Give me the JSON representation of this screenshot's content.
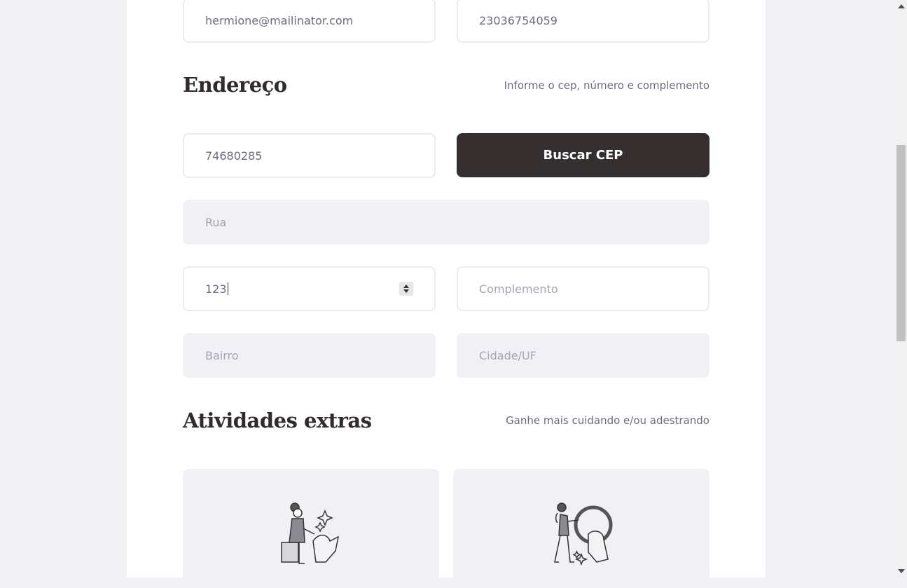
{
  "contact": {
    "email_value": "hermione@mailinator.com",
    "phone_value": "23036754059"
  },
  "address": {
    "title": "Endereço",
    "hint": "Informe o cep, número e complemento",
    "cep_value": "74680285",
    "search_button": "Buscar CEP",
    "street_placeholder": "Rua",
    "number_value": "123",
    "complement_placeholder": "Complemento",
    "district_placeholder": "Bairro",
    "city_placeholder": "Cidade/UF"
  },
  "activities": {
    "title": "Atividades extras",
    "hint": "Ganhe mais cuidando e/ou adestrando",
    "items": [
      {
        "icon": "pet-care-illustration-icon"
      },
      {
        "icon": "dog-training-illustration-icon"
      }
    ]
  }
}
